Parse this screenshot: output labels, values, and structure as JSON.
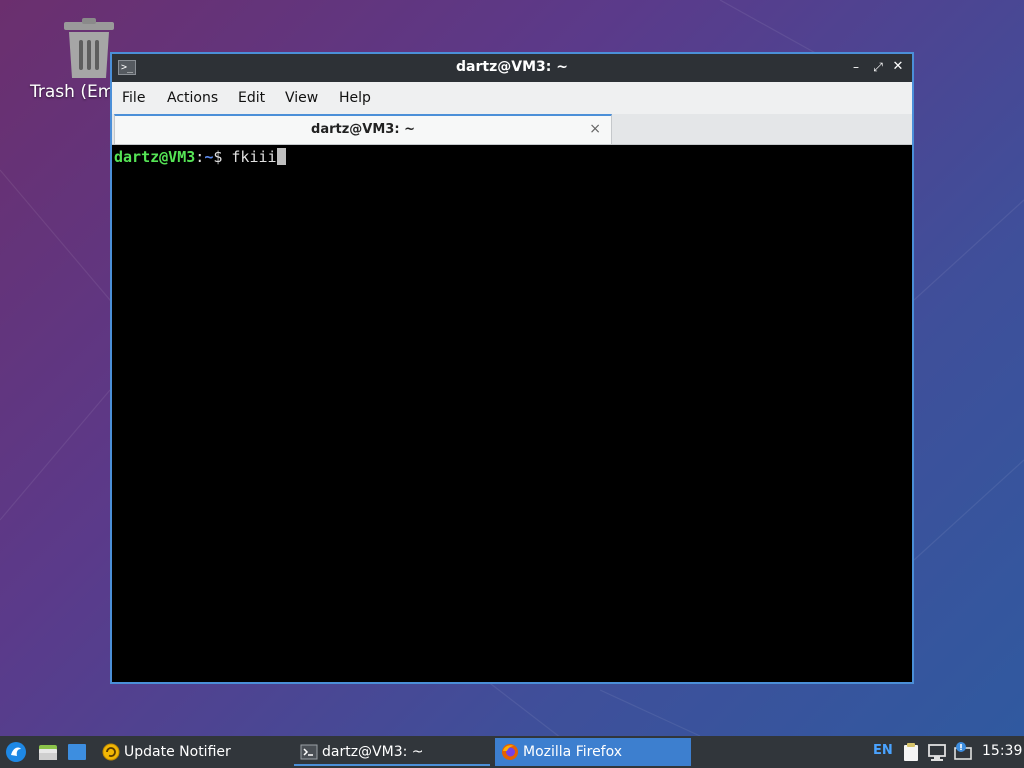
{
  "desktop": {
    "trash_label": "Trash (Em"
  },
  "window": {
    "title": "dartz@VM3: ~",
    "menu": [
      "File",
      "Actions",
      "Edit",
      "View",
      "Help"
    ],
    "tab_label": "dartz@VM3: ~",
    "tab_close": "×",
    "controls": {
      "minimize": "–",
      "maximize": "⤢",
      "close": "✕"
    }
  },
  "terminal": {
    "prompt_user": "dartz@VM3",
    "prompt_sep": ":",
    "prompt_path": "~",
    "prompt_symbol": "$ ",
    "command": "fkiii"
  },
  "taskbar": {
    "tasks": [
      {
        "label": "Update Notifier",
        "icon": "update-notifier-icon"
      },
      {
        "label": "dartz@VM3: ~",
        "icon": "terminal-icon"
      },
      {
        "label": "Mozilla Firefox",
        "icon": "firefox-icon"
      }
    ],
    "keyboard_layout": "EN",
    "clock": "15:39"
  },
  "colors": {
    "accent": "#4b8fd8",
    "prompt_user": "#55e455",
    "prompt_path": "#5c8cf0",
    "taskbar": "#31363b"
  }
}
